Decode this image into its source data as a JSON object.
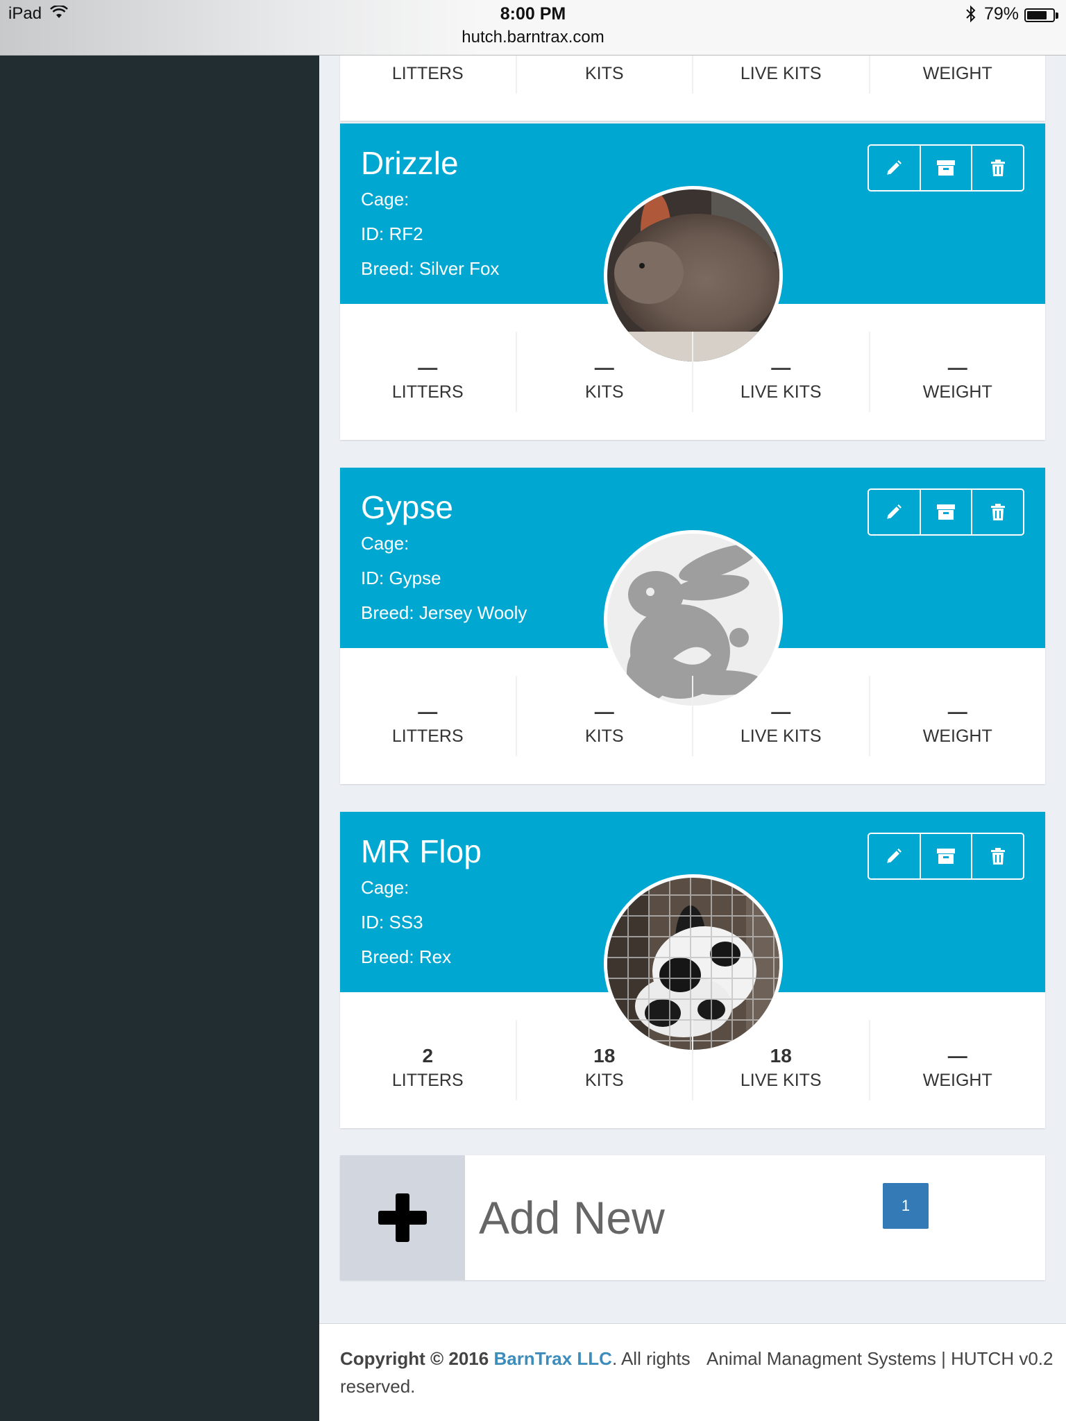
{
  "status_bar": {
    "device": "iPad",
    "time": "8:00 PM",
    "url": "hutch.barntrax.com",
    "battery": "79%",
    "battery_level": 0.79
  },
  "top_card": {
    "stat_labels": [
      "LITTERS",
      "KITS",
      "LIVE KITS",
      "WEIGHT"
    ]
  },
  "rabbits": [
    {
      "name": "Drizzle",
      "cage": "Cage:",
      "id": "ID: RF2",
      "breed": "Breed: Silver Fox",
      "avatar": "photo-brown-rabbit",
      "stats": [
        {
          "value": "—",
          "label": "LITTERS"
        },
        {
          "value": "—",
          "label": "KITS"
        },
        {
          "value": "—",
          "label": "LIVE KITS"
        },
        {
          "value": "—",
          "label": "WEIGHT"
        }
      ]
    },
    {
      "name": "Gypse",
      "cage": "Cage:",
      "id": "ID: Gypse",
      "breed": "Breed: Jersey Wooly",
      "avatar": "rabbit-silhouette-placeholder",
      "stats": [
        {
          "value": "—",
          "label": "LITTERS"
        },
        {
          "value": "—",
          "label": "KITS"
        },
        {
          "value": "—",
          "label": "LIVE KITS"
        },
        {
          "value": "—",
          "label": "WEIGHT"
        }
      ]
    },
    {
      "name": "MR Flop",
      "cage": "Cage:",
      "id": "ID: SS3",
      "breed": "Breed: Rex",
      "avatar": "photo-black-white-rabbit-in-cage",
      "stats": [
        {
          "value": "2",
          "label": "LITTERS"
        },
        {
          "value": "18",
          "label": "KITS"
        },
        {
          "value": "18",
          "label": "LIVE KITS"
        },
        {
          "value": "—",
          "label": "WEIGHT"
        }
      ]
    }
  ],
  "actions": {
    "edit_icon": "pencil-icon",
    "archive_icon": "archive-icon",
    "delete_icon": "trash-icon"
  },
  "add_new": {
    "label": "Add New",
    "icon": "plus-icon",
    "page": "1"
  },
  "footer": {
    "copyright_prefix": "Copyright © 2016",
    "brand": "BarnTrax LLC",
    "copyright_suffix": ". All rights reserved.",
    "right_text": "Animal Managment Systems | HUTCH v0.2"
  },
  "colors": {
    "sidebar": "#222d32",
    "card_header": "#00a7d0",
    "page_button": "#337ab7",
    "brand_link": "#3c8dbc"
  }
}
